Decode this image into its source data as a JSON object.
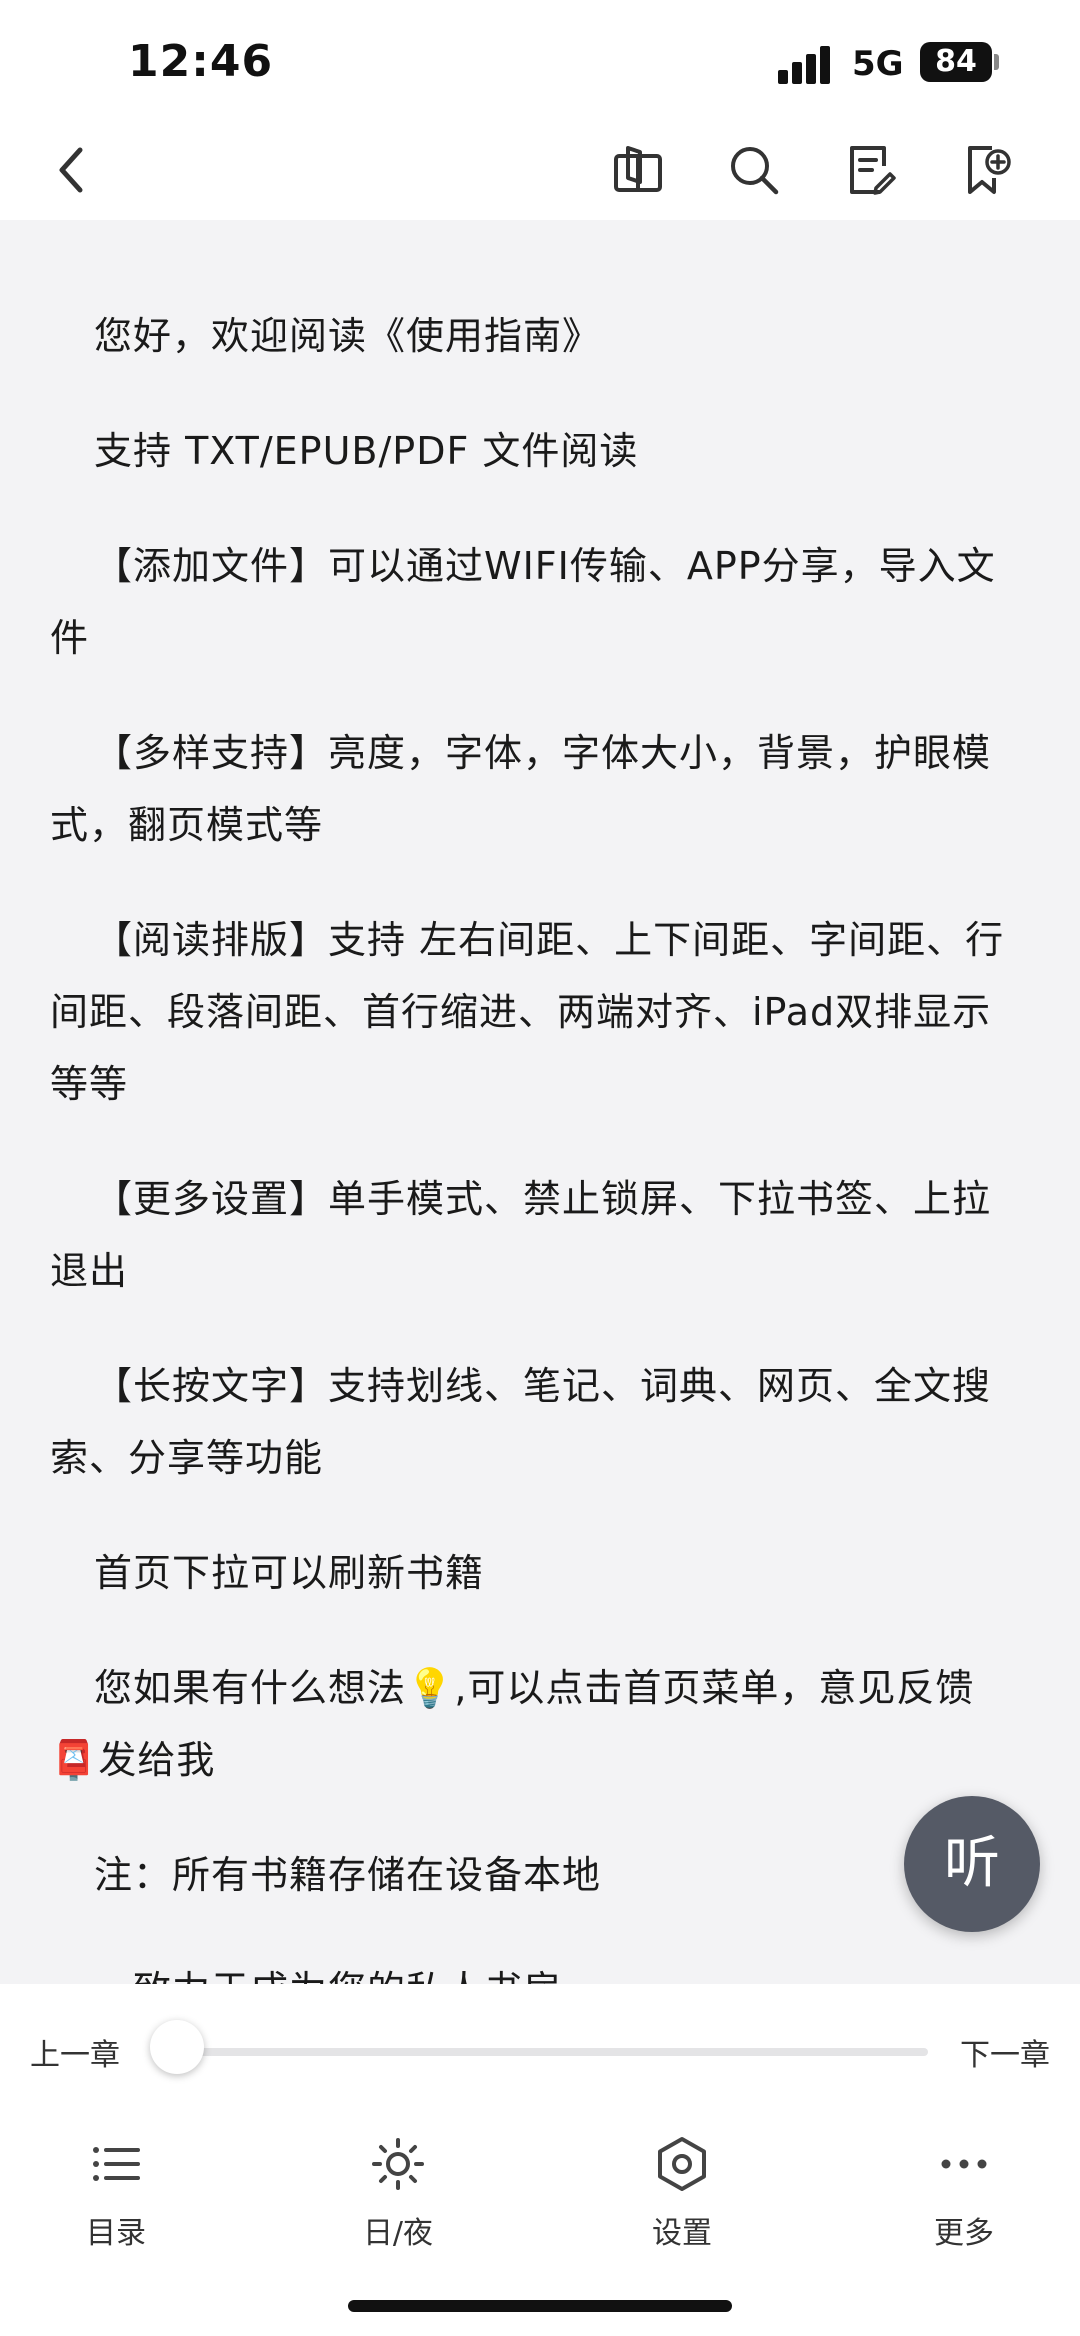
{
  "status": {
    "time": "12:46",
    "network": "5G",
    "battery": "84"
  },
  "toolbar": {
    "icons": [
      "back-icon",
      "book-icon",
      "search-icon",
      "notes-icon",
      "bookmark-add-icon"
    ]
  },
  "content": {
    "paragraphs": [
      "您好，欢迎阅读《使用指南》",
      "支持 TXT/EPUB/PDF 文件阅读",
      "【添加文件】可以通过WIFI传输、APP分享，导入文件",
      "【多样支持】亮度，字体，字体大小，背景，护眼模式，翻页模式等",
      "【阅读排版】支持 左右间距、上下间距、字间距、行间距、段落间距、首行缩进、两端对齐、iPad双排显示 等等",
      "【更多设置】单手模式、禁止锁屏、下拉书签、上拉退出",
      "【长按文字】支持划线、笔记、词典、网页、全文搜索、分享等功能",
      "首页下拉可以刷新书籍",
      "您如果有什么想法💡,可以点击首页菜单，意见反馈📮发给我",
      "注：所有书籍存储在设备本地",
      "一致力于成为您的私人书房"
    ]
  },
  "listen_button": {
    "label": "听"
  },
  "chapter_nav": {
    "prev_label": "上一章",
    "next_label": "下一章",
    "progress": 0.03
  },
  "bottom_tabs": [
    {
      "label": "目录",
      "icon": "list-icon"
    },
    {
      "label": "日/夜",
      "icon": "sun-icon"
    },
    {
      "label": "设置",
      "icon": "settings-icon"
    },
    {
      "label": "更多",
      "icon": "more-icon"
    }
  ]
}
